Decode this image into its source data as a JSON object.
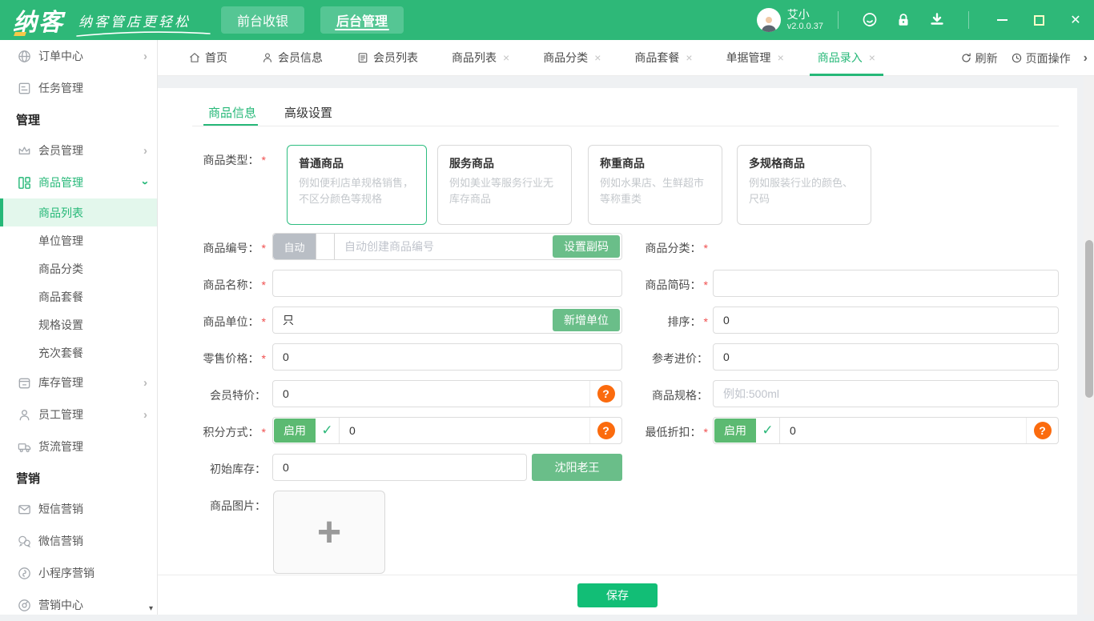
{
  "colors": {
    "brand_green": "#2EB878",
    "accent_green": "#12BE76",
    "button_green": "#6ABE89",
    "active_item_bg": "#E3F7EC",
    "help_orange": "#FB6B0E",
    "required_red": "#F04F4F"
  },
  "icons": {
    "close_tab": "×",
    "check": "✓",
    "plus": "+",
    "question": "?",
    "chevron_right": "›",
    "scroll_down": "▾",
    "window_minimize": "—",
    "window_close": "✕"
  },
  "header": {
    "logo": "纳客",
    "slogan": "纳客管店更轻松",
    "nav": [
      {
        "label": "前台收银"
      },
      {
        "label": "后台管理"
      }
    ],
    "user_name": "艾小",
    "version": "v2.0.0.37"
  },
  "tabbar": {
    "tabs": [
      {
        "label": "首页"
      },
      {
        "label": "会员信息"
      },
      {
        "label": "会员列表"
      },
      {
        "label": "商品列表"
      },
      {
        "label": "商品分类"
      },
      {
        "label": "商品套餐"
      },
      {
        "label": "单据管理"
      },
      {
        "label": "商品录入"
      }
    ],
    "refresh": "刷新",
    "page_ops": "页面操作"
  },
  "sidebar": {
    "items": [
      {
        "label": "订单中心"
      },
      {
        "label": "任务管理"
      },
      {
        "label": "管理"
      },
      {
        "label": "会员管理"
      },
      {
        "label": "商品管理"
      },
      {
        "label": "商品列表"
      },
      {
        "label": "单位管理"
      },
      {
        "label": "商品分类"
      },
      {
        "label": "商品套餐"
      },
      {
        "label": "规格设置"
      },
      {
        "label": "充次套餐"
      },
      {
        "label": "库存管理"
      },
      {
        "label": "员工管理"
      },
      {
        "label": "货流管理"
      },
      {
        "label": "营销"
      },
      {
        "label": "短信营销"
      },
      {
        "label": "微信营销"
      },
      {
        "label": "小程序营销"
      },
      {
        "label": "营销中心"
      }
    ]
  },
  "form": {
    "required_mark": "*",
    "tabs": [
      {
        "label": "商品信息"
      },
      {
        "label": "高级设置"
      }
    ],
    "type": {
      "label": "商品类型：",
      "cards": [
        {
          "title": "普通商品",
          "desc": "例如便利店单规格销售，不区分颜色等规格"
        },
        {
          "title": "服务商品",
          "desc": "例如美业等服务行业无库存商品"
        },
        {
          "title": "称重商品",
          "desc": "例如水果店、生鲜超市等称重类"
        },
        {
          "title": "多规格商品",
          "desc": "例如服装行业的颜色、尺码"
        }
      ]
    },
    "fields": {
      "code": {
        "label": "商品编号：",
        "toggle_label": "自动",
        "placeholder": "自动创建商品编号",
        "button": "设置副码"
      },
      "category": {
        "label": "商品分类："
      },
      "name": {
        "label": "商品名称：",
        "value": ""
      },
      "shortcode": {
        "label": "商品简码：",
        "value": ""
      },
      "unit": {
        "label": "商品单位：",
        "value": "只",
        "button": "新增单位"
      },
      "sort": {
        "label": "排序：",
        "value": "0"
      },
      "retail_price": {
        "label": "零售价格：",
        "value": "0"
      },
      "purchase_price": {
        "label": "参考进价：",
        "value": "0"
      },
      "member_price": {
        "label": "会员特价：",
        "value": "0"
      },
      "spec": {
        "label": "商品规格：",
        "placeholder": "例如:500ml"
      },
      "points": {
        "label": "积分方式：",
        "toggle_label": "启用",
        "value": "0"
      },
      "min_discount": {
        "label": "最低折扣：",
        "toggle_label": "启用",
        "value": "0"
      },
      "init_stock": {
        "label": "初始库存：",
        "value": "0",
        "button": "沈阳老王"
      },
      "image": {
        "label": "商品图片："
      }
    },
    "save": "保存"
  }
}
